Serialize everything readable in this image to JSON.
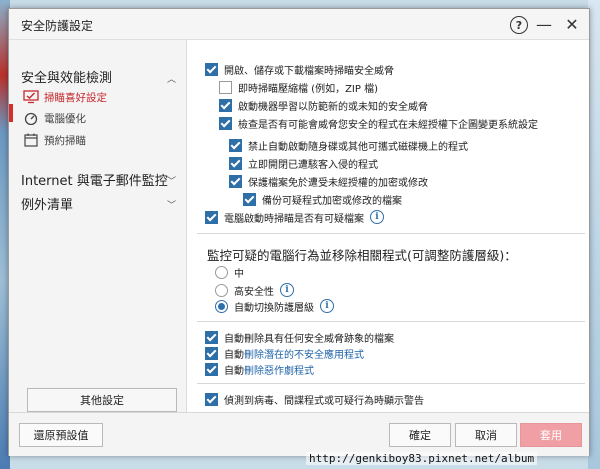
{
  "window": {
    "title": "安全防護設定"
  },
  "sidebar": {
    "sections": [
      {
        "label": "安全與效能檢測"
      },
      {
        "label": "Internet 與電子郵件監控"
      },
      {
        "label": "例外清單"
      }
    ],
    "items": [
      {
        "label": "掃瞄喜好設定"
      },
      {
        "label": "電腦優化"
      },
      {
        "label": "預約掃瞄"
      }
    ],
    "other_button": "其他設定"
  },
  "content": {
    "options": [
      {
        "label": "開啟、儲存或下載檔案時掃瞄安全威脅"
      },
      {
        "label": "即時掃瞄壓縮檔 (例如，ZIP 檔)"
      },
      {
        "label": "啟動機器學習以防範新的或未知的安全威脅"
      },
      {
        "label": "檢查是否有可能會威脅您安全的程式在未經授權下企圖變更系統設定"
      },
      {
        "label": "禁止自動啟動隨身碟或其他可攜式磁碟機上的程式"
      },
      {
        "label": "立即開閉已遭駭客入侵的程式"
      },
      {
        "label": "保護檔案免於遭受未經授權的加密或修改"
      },
      {
        "label": "備份可疑程式加密或修改的檔案"
      },
      {
        "label": "電腦啟動時掃瞄是否有可疑檔案"
      }
    ],
    "heading": "監控可疑的電腦行為並移除相關程式(可調整防護層級)：",
    "radios": [
      {
        "label": "中"
      },
      {
        "label": "高安全性"
      },
      {
        "label": "自動切換防護層級"
      }
    ],
    "delete_opts": {
      "opt1": "自動刪除具有任何安全威脅跡象的檔案",
      "opt2_prefix": "自動",
      "opt2_link": "刪除潛在的不安全應用程式",
      "opt3_prefix": "自動",
      "opt3_link": "刪除惡作劇程式"
    },
    "warn": "偵測到病毒、間諜程式或可疑行為時顯示警告"
  },
  "footer": {
    "restore": "還原預設值",
    "ok": "確定",
    "cancel": "取消",
    "apply": "套用"
  },
  "watermark": "http://genkiboy83.pixnet.net/album",
  "colors": {
    "accent": "#2f6fa8",
    "active": "#c6282e",
    "apply": "#f0a0a5"
  }
}
